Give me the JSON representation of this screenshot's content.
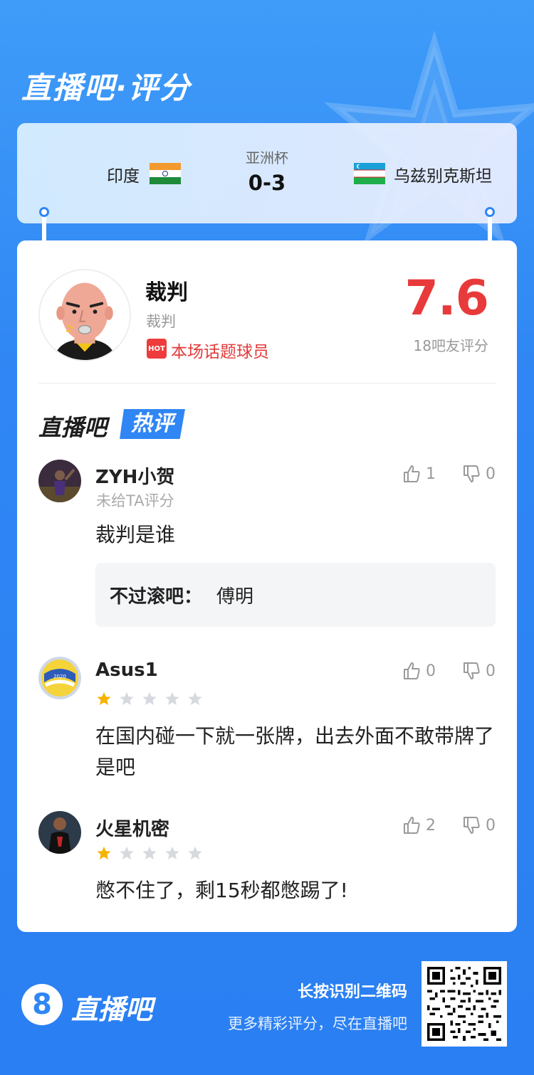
{
  "brand": {
    "title": "直播吧·评分"
  },
  "match": {
    "league": "亚洲杯",
    "score": "0-3",
    "home_team": "印度",
    "away_team": "乌兹别克斯坦"
  },
  "subject": {
    "name": "裁判",
    "role": "裁判",
    "hot_badge": "HOT",
    "hot_label": "本场话题球员",
    "rating": "7.6",
    "rating_count": "18吧友评分"
  },
  "hot_section": {
    "title_prefix": "直播吧",
    "title_suffix": "热评"
  },
  "comments": [
    {
      "user": "ZYH小贺",
      "sub": "未给TA评分",
      "text": "裁判是谁",
      "likes": "1",
      "dislikes": "0",
      "reply": {
        "user": "不过滚吧：",
        "text": "傅明"
      }
    },
    {
      "user": "Asus1",
      "stars": 1,
      "text": "在国内碰一下就一张牌，出去外面不敢带牌了是吧",
      "likes": "0",
      "dislikes": "0"
    },
    {
      "user": "火星机密",
      "stars": 1,
      "text": "憋不住了，剩15秒都憋踢了!",
      "likes": "2",
      "dislikes": "0"
    }
  ],
  "footer": {
    "logo_glyph": "8",
    "brand": "直播吧",
    "cta": "长按识别二维码",
    "sub": "更多精彩评分，尽在直播吧"
  },
  "colors": {
    "accent": "#2f86f4",
    "rating": "#e83a3a",
    "star": "#f5b400"
  }
}
